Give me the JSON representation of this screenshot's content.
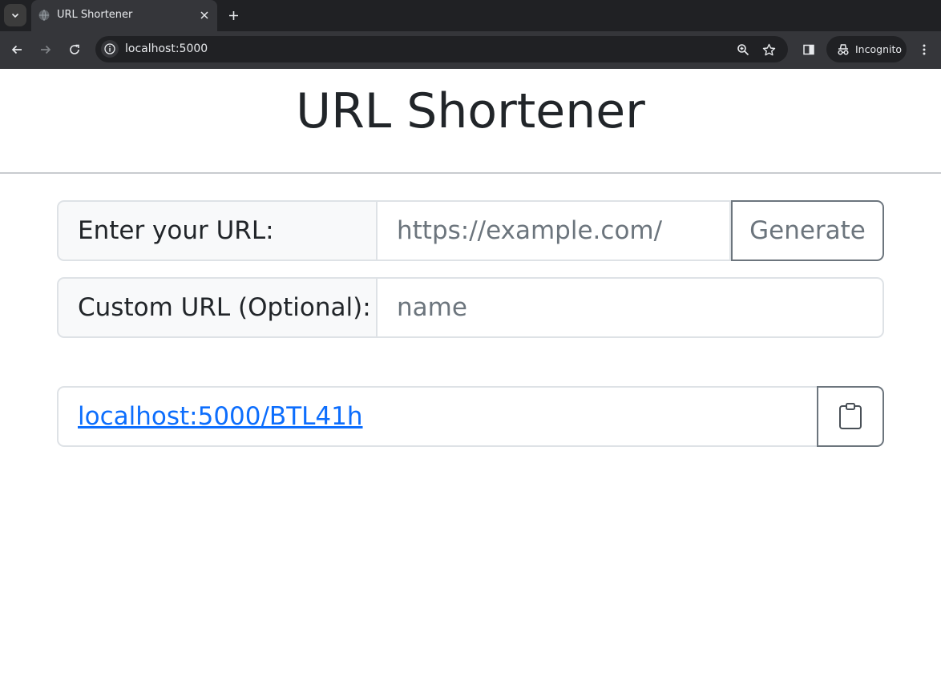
{
  "browser": {
    "tab_title": "URL Shortener",
    "address": "localhost:5000",
    "incognito_label": "Incognito",
    "icons": [
      "tab-search-icon",
      "globe-icon",
      "close-icon",
      "plus-icon",
      "back-icon",
      "forward-icon",
      "reload-icon",
      "info-icon",
      "zoom-icon",
      "star-icon",
      "side-panel-icon",
      "incognito-icon",
      "kebab-menu-icon"
    ]
  },
  "page": {
    "title": "URL Shortener",
    "url_label": "Enter your URL:",
    "url_placeholder": "https://example.com/",
    "url_value": "",
    "generate_label": "Generate",
    "custom_label": "Custom URL (Optional):",
    "custom_placeholder": "name",
    "custom_value": "",
    "result_link": "localhost:5000/BTL41h",
    "copy_icon": "clipboard-icon"
  },
  "colors": {
    "link": "#0d6efd",
    "secondary": "#6c757d",
    "text": "#212529",
    "chrome_dark": "#202124",
    "chrome_toolbar": "#35363a"
  }
}
